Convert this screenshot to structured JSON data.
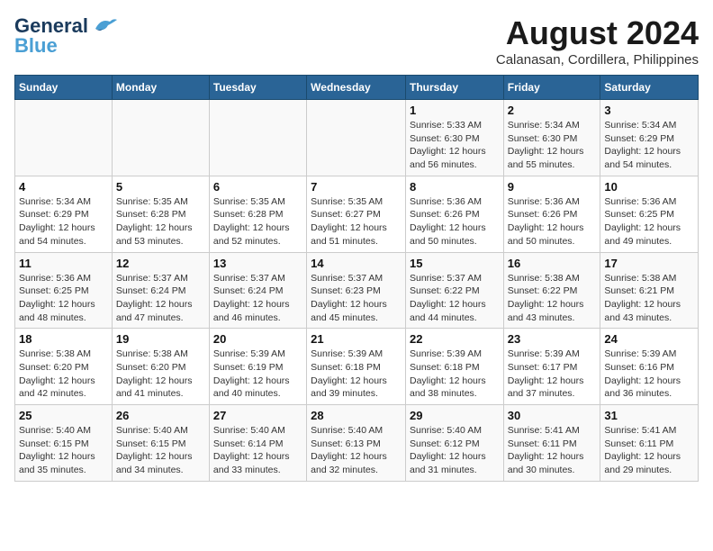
{
  "header": {
    "logo_general": "General",
    "logo_blue": "Blue",
    "main_title": "August 2024",
    "subtitle": "Calanasan, Cordillera, Philippines"
  },
  "weekdays": [
    "Sunday",
    "Monday",
    "Tuesday",
    "Wednesday",
    "Thursday",
    "Friday",
    "Saturday"
  ],
  "weeks": [
    [
      {
        "day": "",
        "info": ""
      },
      {
        "day": "",
        "info": ""
      },
      {
        "day": "",
        "info": ""
      },
      {
        "day": "",
        "info": ""
      },
      {
        "day": "1",
        "info": "Sunrise: 5:33 AM\nSunset: 6:30 PM\nDaylight: 12 hours\nand 56 minutes."
      },
      {
        "day": "2",
        "info": "Sunrise: 5:34 AM\nSunset: 6:30 PM\nDaylight: 12 hours\nand 55 minutes."
      },
      {
        "day": "3",
        "info": "Sunrise: 5:34 AM\nSunset: 6:29 PM\nDaylight: 12 hours\nand 54 minutes."
      }
    ],
    [
      {
        "day": "4",
        "info": "Sunrise: 5:34 AM\nSunset: 6:29 PM\nDaylight: 12 hours\nand 54 minutes."
      },
      {
        "day": "5",
        "info": "Sunrise: 5:35 AM\nSunset: 6:28 PM\nDaylight: 12 hours\nand 53 minutes."
      },
      {
        "day": "6",
        "info": "Sunrise: 5:35 AM\nSunset: 6:28 PM\nDaylight: 12 hours\nand 52 minutes."
      },
      {
        "day": "7",
        "info": "Sunrise: 5:35 AM\nSunset: 6:27 PM\nDaylight: 12 hours\nand 51 minutes."
      },
      {
        "day": "8",
        "info": "Sunrise: 5:36 AM\nSunset: 6:26 PM\nDaylight: 12 hours\nand 50 minutes."
      },
      {
        "day": "9",
        "info": "Sunrise: 5:36 AM\nSunset: 6:26 PM\nDaylight: 12 hours\nand 50 minutes."
      },
      {
        "day": "10",
        "info": "Sunrise: 5:36 AM\nSunset: 6:25 PM\nDaylight: 12 hours\nand 49 minutes."
      }
    ],
    [
      {
        "day": "11",
        "info": "Sunrise: 5:36 AM\nSunset: 6:25 PM\nDaylight: 12 hours\nand 48 minutes."
      },
      {
        "day": "12",
        "info": "Sunrise: 5:37 AM\nSunset: 6:24 PM\nDaylight: 12 hours\nand 47 minutes."
      },
      {
        "day": "13",
        "info": "Sunrise: 5:37 AM\nSunset: 6:24 PM\nDaylight: 12 hours\nand 46 minutes."
      },
      {
        "day": "14",
        "info": "Sunrise: 5:37 AM\nSunset: 6:23 PM\nDaylight: 12 hours\nand 45 minutes."
      },
      {
        "day": "15",
        "info": "Sunrise: 5:37 AM\nSunset: 6:22 PM\nDaylight: 12 hours\nand 44 minutes."
      },
      {
        "day": "16",
        "info": "Sunrise: 5:38 AM\nSunset: 6:22 PM\nDaylight: 12 hours\nand 43 minutes."
      },
      {
        "day": "17",
        "info": "Sunrise: 5:38 AM\nSunset: 6:21 PM\nDaylight: 12 hours\nand 43 minutes."
      }
    ],
    [
      {
        "day": "18",
        "info": "Sunrise: 5:38 AM\nSunset: 6:20 PM\nDaylight: 12 hours\nand 42 minutes."
      },
      {
        "day": "19",
        "info": "Sunrise: 5:38 AM\nSunset: 6:20 PM\nDaylight: 12 hours\nand 41 minutes."
      },
      {
        "day": "20",
        "info": "Sunrise: 5:39 AM\nSunset: 6:19 PM\nDaylight: 12 hours\nand 40 minutes."
      },
      {
        "day": "21",
        "info": "Sunrise: 5:39 AM\nSunset: 6:18 PM\nDaylight: 12 hours\nand 39 minutes."
      },
      {
        "day": "22",
        "info": "Sunrise: 5:39 AM\nSunset: 6:18 PM\nDaylight: 12 hours\nand 38 minutes."
      },
      {
        "day": "23",
        "info": "Sunrise: 5:39 AM\nSunset: 6:17 PM\nDaylight: 12 hours\nand 37 minutes."
      },
      {
        "day": "24",
        "info": "Sunrise: 5:39 AM\nSunset: 6:16 PM\nDaylight: 12 hours\nand 36 minutes."
      }
    ],
    [
      {
        "day": "25",
        "info": "Sunrise: 5:40 AM\nSunset: 6:15 PM\nDaylight: 12 hours\nand 35 minutes."
      },
      {
        "day": "26",
        "info": "Sunrise: 5:40 AM\nSunset: 6:15 PM\nDaylight: 12 hours\nand 34 minutes."
      },
      {
        "day": "27",
        "info": "Sunrise: 5:40 AM\nSunset: 6:14 PM\nDaylight: 12 hours\nand 33 minutes."
      },
      {
        "day": "28",
        "info": "Sunrise: 5:40 AM\nSunset: 6:13 PM\nDaylight: 12 hours\nand 32 minutes."
      },
      {
        "day": "29",
        "info": "Sunrise: 5:40 AM\nSunset: 6:12 PM\nDaylight: 12 hours\nand 31 minutes."
      },
      {
        "day": "30",
        "info": "Sunrise: 5:41 AM\nSunset: 6:11 PM\nDaylight: 12 hours\nand 30 minutes."
      },
      {
        "day": "31",
        "info": "Sunrise: 5:41 AM\nSunset: 6:11 PM\nDaylight: 12 hours\nand 29 minutes."
      }
    ]
  ]
}
